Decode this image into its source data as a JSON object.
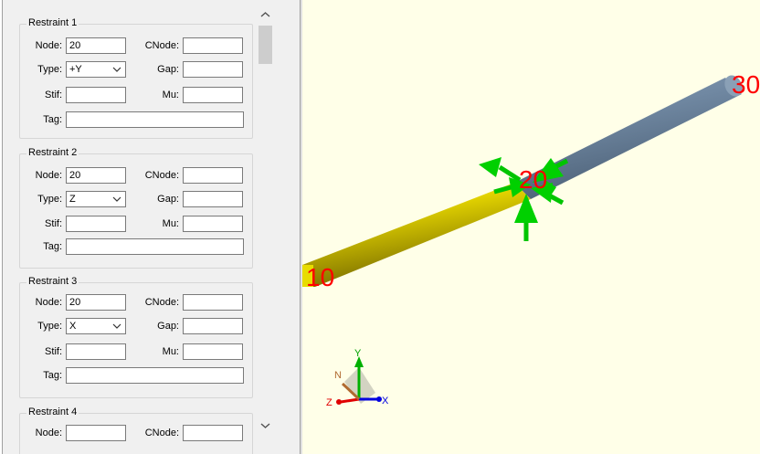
{
  "restraints": [
    {
      "title": "Restraint 1",
      "node_label": "Node:",
      "node": "20",
      "cnode_label": "CNode:",
      "cnode": "",
      "type_label": "Type:",
      "type": "+Y",
      "gap_label": "Gap:",
      "gap": "",
      "stif_label": "Stif:",
      "stif": "",
      "mu_label": "Mu:",
      "mu": "",
      "tag_label": "Tag:",
      "tag": ""
    },
    {
      "title": "Restraint 2",
      "node_label": "Node:",
      "node": "20",
      "cnode_label": "CNode:",
      "cnode": "",
      "type_label": "Type:",
      "type": "Z",
      "gap_label": "Gap:",
      "gap": "",
      "stif_label": "Stif:",
      "stif": "",
      "mu_label": "Mu:",
      "mu": "",
      "tag_label": "Tag:",
      "tag": ""
    },
    {
      "title": "Restraint 3",
      "node_label": "Node:",
      "node": "20",
      "cnode_label": "CNode:",
      "cnode": "",
      "type_label": "Type:",
      "type": "X",
      "gap_label": "Gap:",
      "gap": "",
      "stif_label": "Stif:",
      "stif": "",
      "mu_label": "Mu:",
      "mu": "",
      "tag_label": "Tag:",
      "tag": ""
    },
    {
      "title": "Restraint 4",
      "node_label": "Node:",
      "cnode_label": "CNode:"
    }
  ],
  "viewport": {
    "node_labels": [
      "10",
      "20",
      "30"
    ],
    "axis_labels": {
      "y": "Y",
      "x": "X",
      "z": "Z",
      "n": "N"
    },
    "colors": {
      "background": "#ffffe8",
      "pipe_selected": "#c8b400",
      "pipe": "#6f86a0",
      "restraint_arrows": "#00cc00",
      "node_label": "#ff0000"
    }
  }
}
